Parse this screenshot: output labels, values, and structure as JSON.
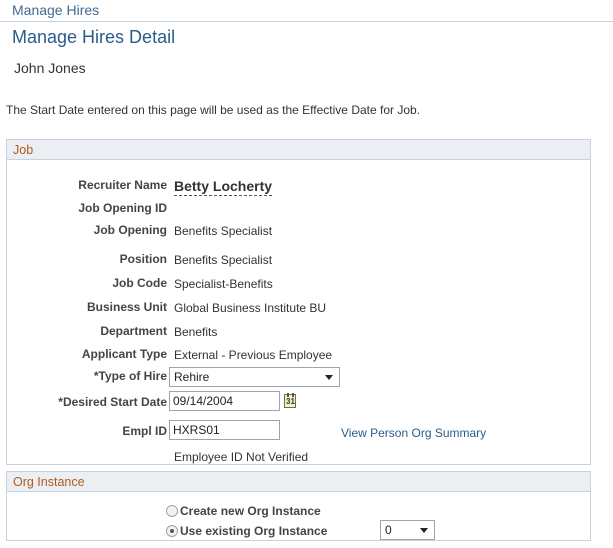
{
  "header": {
    "breadcrumb": "Manage Hires",
    "title": "Manage Hires Detail",
    "person_name": "John Jones",
    "info_text": "The Start Date entered on this page will be used as the Effective Date for Job."
  },
  "job": {
    "section_title": "Job",
    "recruiter_name_label": "Recruiter Name",
    "recruiter_name": "Betty Locherty",
    "job_opening_id_label": "Job Opening ID",
    "job_opening_id": "",
    "job_opening_label": "Job Opening",
    "job_opening": "Benefits Specialist",
    "position_label": "Position",
    "position": "Benefits Specialist",
    "job_code_label": "Job Code",
    "job_code": "Specialist-Benefits",
    "business_unit_label": "Business Unit",
    "business_unit": "Global Business Institute BU",
    "department_label": "Department",
    "department": "Benefits",
    "applicant_type_label": "Applicant Type",
    "applicant_type": "External - Previous Employee",
    "type_of_hire_label": "*Type of Hire",
    "type_of_hire": "Rehire",
    "desired_start_date_label": "*Desired Start Date",
    "desired_start_date": "09/14/2004",
    "calendar_icon_text": "31",
    "empl_id_label": "Empl ID",
    "empl_id": "HXRS01",
    "view_person_org_link": "View Person Org Summary",
    "employee_status_text": "Employee ID Not Verified"
  },
  "org_instance": {
    "section_title": "Org Instance",
    "create_new_label": "Create new Org Instance",
    "use_existing_label": "Use existing Org Instance",
    "selected_option": "use_existing",
    "instance_value": "0"
  }
}
